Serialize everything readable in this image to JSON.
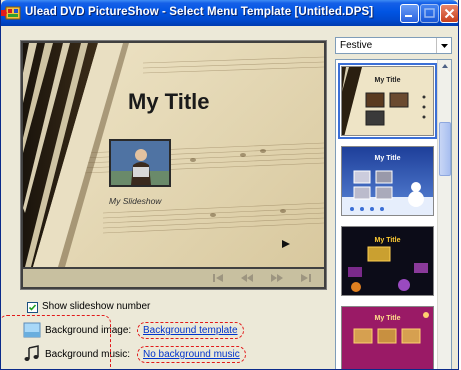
{
  "window": {
    "title": "Ulead DVD PictureShow - Select Menu Template [Untitled.DPS]"
  },
  "preview": {
    "title": "My Title",
    "caption": "My Slideshow"
  },
  "template_picker": {
    "selected_category": "Festive",
    "templates": [
      {
        "title": "My Title"
      },
      {
        "title": "My Title"
      },
      {
        "title": "My Title"
      },
      {
        "title": "My Title"
      }
    ]
  },
  "options": {
    "show_number_label": "Show slideshow number",
    "show_number_checked": true,
    "bg_image_label": "Background image:",
    "bg_image_value": "Background template",
    "bg_music_label": "Background music:",
    "bg_music_value": "No background music"
  },
  "colors": {
    "titlebar": "#0054e3",
    "accent": "#3b6fd6",
    "annotation": "#e21a1a",
    "link": "#0033cc"
  }
}
